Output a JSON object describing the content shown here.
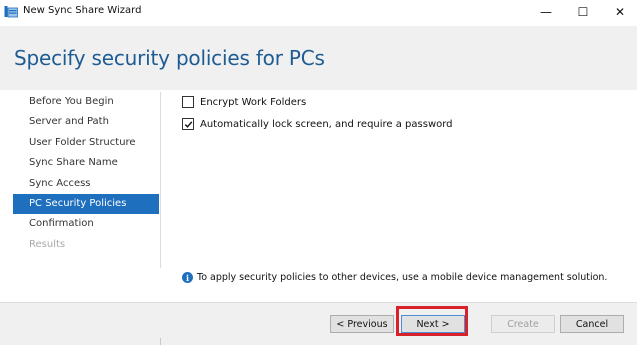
{
  "window": {
    "title": "New Sync Share Wizard",
    "controls": {
      "minimize": "—",
      "maximize": "☐",
      "close": "✕"
    }
  },
  "header": {
    "title": "Specify security policies for PCs"
  },
  "steps": [
    {
      "label": "Before You Begin",
      "state": "normal"
    },
    {
      "label": "Server and Path",
      "state": "normal"
    },
    {
      "label": "User Folder Structure",
      "state": "normal"
    },
    {
      "label": "Sync Share Name",
      "state": "normal"
    },
    {
      "label": "Sync Access",
      "state": "normal"
    },
    {
      "label": "PC Security Policies",
      "state": "active"
    },
    {
      "label": "Confirmation",
      "state": "normal"
    },
    {
      "label": "Results",
      "state": "disabled"
    }
  ],
  "options": [
    {
      "label": "Encrypt Work Folders",
      "checked": false
    },
    {
      "label": "Automatically lock screen, and require a password",
      "checked": true
    }
  ],
  "info": {
    "icon": "info-icon",
    "text": "To apply security policies to other devices, use a mobile device management solution."
  },
  "buttons": {
    "previous": "< Previous",
    "next": "Next >",
    "create": "Create",
    "cancel": "Cancel"
  },
  "colors": {
    "accent": "#1f6fbf",
    "title": "#1d5c93",
    "highlight": "#d8222b"
  }
}
